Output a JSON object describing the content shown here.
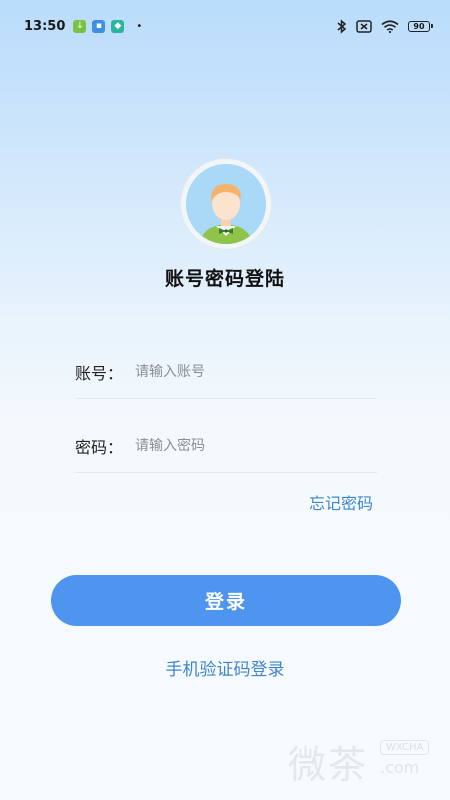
{
  "status_bar": {
    "time": "13:50",
    "battery": "90",
    "notification_icons": [
      "download-icon",
      "message-app-icon",
      "shield-app-icon"
    ],
    "right_icons": [
      "bluetooth-icon",
      "no-sim-icon",
      "wifi-icon",
      "battery-icon"
    ]
  },
  "login": {
    "title": "账号密码登陆",
    "account": {
      "label": "账号：",
      "placeholder": "请输入账号",
      "value": ""
    },
    "password": {
      "label": "密码：",
      "placeholder": "请输入密码",
      "value": ""
    },
    "forgot_label": "忘记密码",
    "submit_label": "登录",
    "sms_login_label": "手机验证码登录"
  },
  "watermark": {
    "text": "微茶",
    "badge": "WXCHA",
    "suffix": ".com"
  },
  "colors": {
    "accent": "#4d95ee",
    "link": "#3e86cc",
    "background_top": "#b9dcfb",
    "background_bottom": "#f7fbfe"
  }
}
